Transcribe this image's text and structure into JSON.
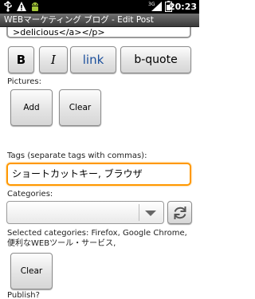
{
  "status_bar": {
    "time": "20:23",
    "icons": [
      "usb-icon",
      "warning-icon",
      "android-debug-icon",
      "cell-signal-icon",
      "battery-icon"
    ]
  },
  "title_bar": {
    "title": "WEBマーケティング ブログ - Edit Post"
  },
  "editor": {
    "body_text": ">delicious</a></p>"
  },
  "format_buttons": {
    "bold": "B",
    "italic": "I",
    "link": "link",
    "bquote": "b-quote"
  },
  "pictures": {
    "label": "Pictures:",
    "add": "Add",
    "clear": "Clear"
  },
  "tags": {
    "label": "Tags (separate tags with commas):",
    "value": "ショートカットキー, ブラウザ"
  },
  "categories": {
    "label": "Categories:",
    "selected_value": "",
    "selected_text": "Selected categories: Firefox, Google Chrome, 便利なWEBツール・サービス,",
    "clear": "Clear"
  },
  "publish": {
    "label": "Publish?"
  },
  "colors": {
    "focus_border": "#ff9800",
    "link_text": "#1b4f9c",
    "status_bar_bg": "#000000"
  }
}
